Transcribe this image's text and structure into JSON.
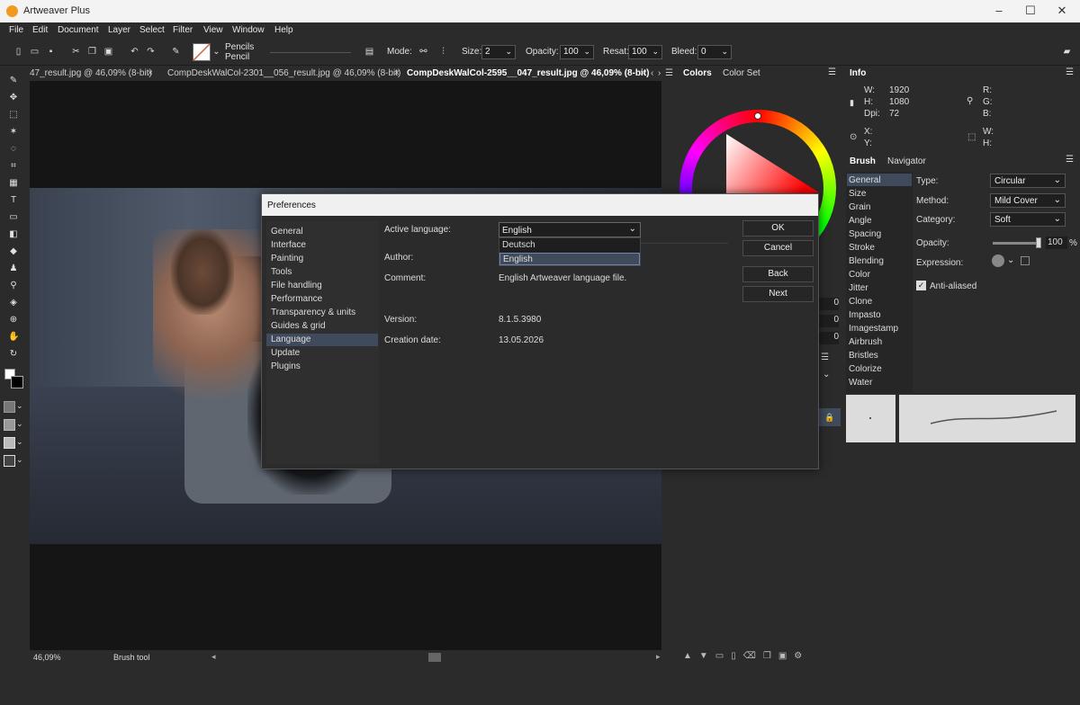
{
  "app": {
    "title": "Artweaver Plus"
  },
  "menu": [
    "File",
    "Edit",
    "Document",
    "Layer",
    "Select",
    "Filter",
    "View",
    "Window",
    "Help"
  ],
  "toolbar": {
    "brush_category": "Pencils",
    "brush_name": "Pencil",
    "mode_label": "Mode:",
    "size_label": "Size:",
    "size_value": "2",
    "opacity_label": "Opacity:",
    "opacity_value": "100",
    "resat_label": "Resat:",
    "resat_value": "100",
    "bleed_label": "Bleed:",
    "bleed_value": "0"
  },
  "documents": {
    "tabs": [
      "47_result.jpg @ 46,09% (8-bit)",
      "CompDeskWalCol-2301__056_result.jpg @ 46,09% (8-bit)",
      "CompDeskWalCol-2595__047_result.jpg @ 46,09% (8-bit)"
    ],
    "close": "×"
  },
  "status": {
    "zoom": "46,09%",
    "tool": "Brush tool"
  },
  "colors_panel": {
    "tabs": [
      "Colors",
      "Color Set"
    ],
    "partial_values": [
      "0",
      "0",
      "0"
    ]
  },
  "info_panel": {
    "title": "Info",
    "w_label": "W:",
    "w_value": "1920",
    "h_label": "H:",
    "h_value": "1080",
    "dpi_label": "Dpi:",
    "dpi_value": "72",
    "r_label": "R:",
    "g_label": "G:",
    "b_label": "B:",
    "x_label": "X:",
    "y_label": "Y:",
    "w2_label": "W:",
    "h2_label": "H:"
  },
  "brush_panel": {
    "tabs": [
      "Brush",
      "Navigator"
    ],
    "categories": [
      "General",
      "Size",
      "Grain",
      "Angle",
      "Spacing",
      "Stroke",
      "Blending",
      "Color",
      "Jitter",
      "Clone",
      "Impasto",
      "Imagestamp",
      "Airbrush",
      "Bristles",
      "Colorize",
      "Water"
    ],
    "type_label": "Type:",
    "type_value": "Circular",
    "method_label": "Method:",
    "method_value": "Mild Cover",
    "category_label": "Category:",
    "category_value": "Soft",
    "opacity_label": "Opacity:",
    "opacity_value": "100",
    "opacity_unit": "%",
    "opacity_level": 1.0,
    "expression_label": "Expression:",
    "anti_aliased_label": "Anti-aliased",
    "anti_aliased": true
  },
  "dialog": {
    "title": "Preferences",
    "nav": [
      "General",
      "Interface",
      "Painting",
      "Tools",
      "File handling",
      "Performance",
      "Transparency & units",
      "Guides & grid",
      "Language",
      "Update",
      "Plugins"
    ],
    "selected": "Language",
    "active_language_label": "Active language:",
    "active_language_value": "English",
    "language_options": [
      "Deutsch",
      "English"
    ],
    "author_label": "Author:",
    "comment_label": "Comment:",
    "comment_value": "English Artweaver language file.",
    "version_label": "Version:",
    "version_value": "8.1.5.3980",
    "creation_label": "Creation date:",
    "creation_value": "13.05.2026",
    "buttons": {
      "ok": "OK",
      "cancel": "Cancel",
      "back": "Back",
      "next": "Next"
    }
  },
  "colors": {
    "accent": "#3f4b5c",
    "dialog_bg": "#2b2b2b",
    "titlebar": "#f3f3f3"
  }
}
